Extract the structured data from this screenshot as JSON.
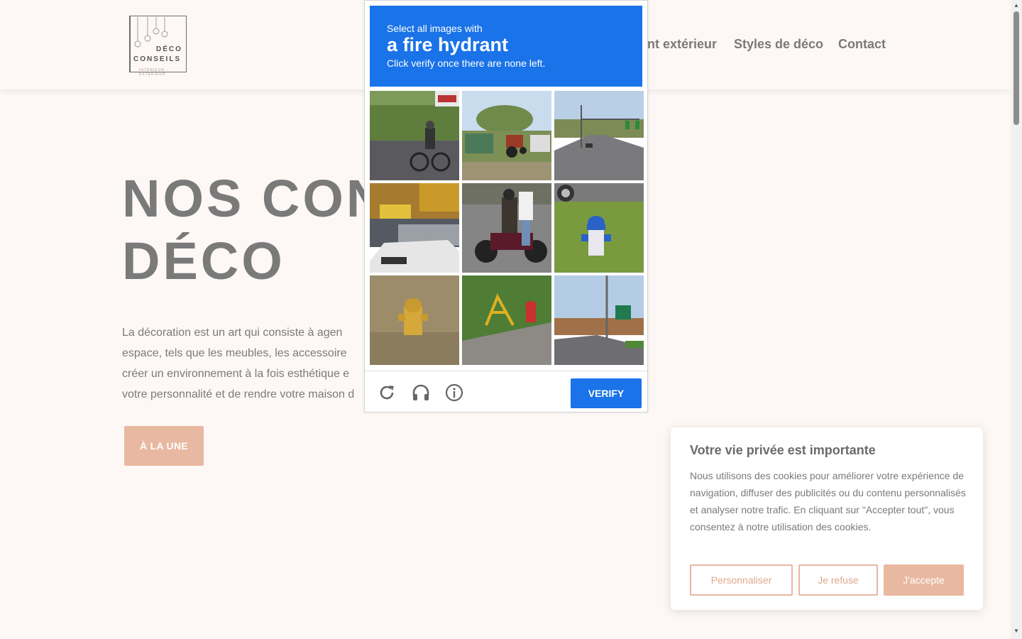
{
  "logo": {
    "line1": "DÉCO",
    "line2": "CONSEILS",
    "tagline": "INTÉRIEUR · EXTÉRIEUR"
  },
  "nav": {
    "items": [
      {
        "label": "nt extérieur"
      },
      {
        "label": "Styles de déco"
      },
      {
        "label": "Contact"
      }
    ]
  },
  "hero": {
    "title_line1": "NOS CON",
    "title_line2": "DÉCO",
    "text_lines": [
      "La décoration est un art qui consiste à agen",
      "espace, tels que les meubles, les accessoire",
      "créer un environnement à la fois esthétique e",
      "votre personnalité et de rendre votre maison d"
    ],
    "cta_label": "À LA UNE"
  },
  "captcha": {
    "prompt_line1": "Select all images with",
    "target": "a fire hydrant",
    "prompt_line3": "Click verify once there are none left.",
    "verify_label": "VERIFY",
    "tiles": [
      {
        "scene": "cyclist on road"
      },
      {
        "scene": "tractor near barn"
      },
      {
        "scene": "street with traffic lights"
      },
      {
        "scene": "parked cars and bus"
      },
      {
        "scene": "motorcycle riders"
      },
      {
        "scene": "blue fire hydrant on grass"
      },
      {
        "scene": "yellow fire hydrant in dry grass"
      },
      {
        "scene": "red fire hydrant by sidewalk"
      },
      {
        "scene": "road with signs"
      }
    ],
    "colors": {
      "header": "#1a73e8"
    }
  },
  "cookie": {
    "title": "Votre vie privée est importante",
    "body": "Nous utilisons des cookies pour améliorer votre expérience de navigation, diffuser des publicités ou du contenu personnalisés et analyser notre trafic. En cliquant sur \"Accepter tout\", vous consentez à notre utilisation des cookies.",
    "btn_customize": "Personnaliser",
    "btn_refuse": "Je refuse",
    "btn_accept": "J'accepte",
    "colors": {
      "accent": "#e8b8a0"
    }
  }
}
